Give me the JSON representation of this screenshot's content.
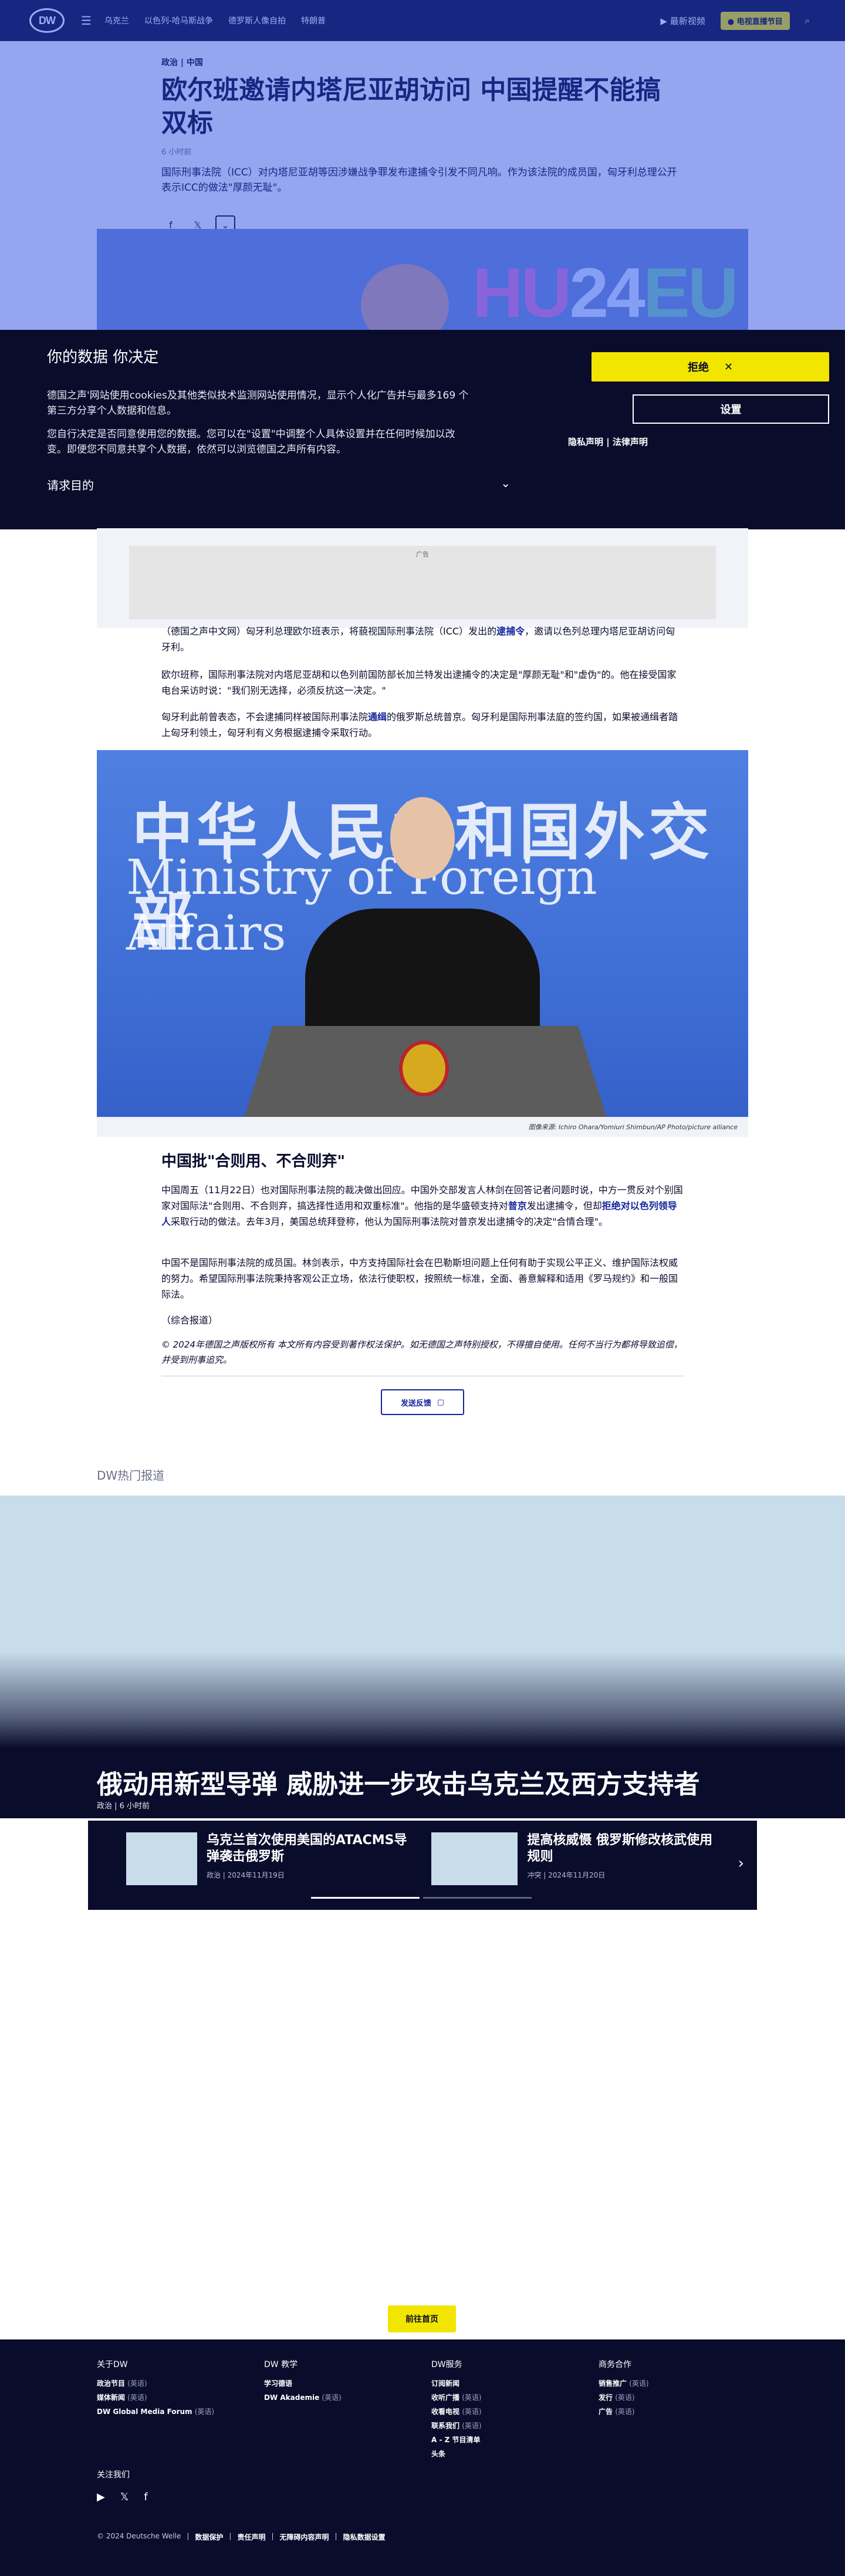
{
  "topbar": {
    "logo": "DW",
    "menu_icon": "menu-icon",
    "nav": [
      "乌克兰",
      "以色列-哈马斯战争",
      "德罗斯人像自拍",
      "特朗普"
    ],
    "live_audio": "最新视频",
    "live_btn": "● 电视直播节目",
    "search_icon": "search-icon"
  },
  "article": {
    "kicker": "政治 | 中国",
    "title": "欧尔班邀请内塔尼亚胡访问 中国提醒不能搞双标",
    "meta": "6 小时前",
    "lead": "国际刑事法院（ICC）对内塔尼亚胡等因涉嫌战争罪发布逮捕令引发不同凡响。作为该法院的成员国，匈牙利总理公开表示ICC的做法\"厚颜无耻\"。",
    "share_icons": [
      "facebook-icon",
      "x-icon",
      "more-icon"
    ]
  },
  "hero": {
    "text_hu": "HU",
    "text_num": "24",
    "text_eu": "EU"
  },
  "cookie": {
    "title": "你的数据 你决定",
    "p1": "德国之声'网站使用cookies及其他类似技术监测网站使用情况，显示个人化广告并与最多169 个第三方分享个人数据和信息。",
    "p2": "您自行决定是否同意使用您的数据。您可以在\"设置\"中调整个人具体设置并在任何时候加以改变。即便您不同意共享个人数据，依然可以浏览德国之声所有内容。",
    "purpose": "请求目的",
    "purpose_icon": "chevron-down-icon",
    "reject": "拒绝",
    "settings": "设置",
    "legal": "隐私声明 | 法律声明"
  },
  "ad": {
    "label": "广告"
  },
  "paragraphs": {
    "p1_a": "（德国之声中文网）匈牙利总理欧尔班表示，将藐视国际刑事法院（ICC）发出的",
    "p1_link": "逮捕令",
    "p1_b": "，邀请以色列总理内塔尼亚胡访问匈牙利。",
    "p2": "欧尔班称，国际刑事法院对内塔尼亚胡和以色列前国防部长加兰特发出逮捕令的决定是\"厚颜无耻\"和\"虚伪\"的。他在接受国家电台采访时说：\"我们别无选择，必须反抗这一决定。\"",
    "p3_a": "匈牙利此前曾表态，不会逮捕同样被国际刑事法院",
    "p3_link": "通缉",
    "p3_b": "的俄罗斯总统普京。匈牙利是国际刑事法庭的签约国，如果被通缉者踏上匈牙利领土，匈牙利有义务根据逮捕令采取行动。",
    "h2": "中国批\"合则用、不合则弃\"",
    "p4_a": "中国周五（11月22日）也对国际刑事法院的裁决做出回应。中国外交部发言人林剑在回答记者问题时说，中方一贯反对个别国家对国际法\"合则用、不合则弃，搞选择性适用和双重标准\"。他指的是华盛顿支持对",
    "p4_link1": "普京",
    "p4_b": "发出逮捕令，但却",
    "p4_link2": "拒绝对以色列领导人",
    "p4_c": "采取行动的做法。去年3月，美国总统拜登称，他认为国际刑事法院对普京发出逮捕令的决定\"合情合理\"。",
    "p5": "中国不是国际刑事法院的成员国。林剑表示，中方支持国际社会在巴勒斯坦问题上任何有助于实现公平正义、维护国际法权威的努力。希望国际刑事法院秉持客观公正立场，依法行使职权，按照统一标准，全面、善意解释和适用《罗马规约》和一般国际法。",
    "p6": "（综合报道）",
    "copyright": "© 2024年德国之声版权所有 本文所有内容受到著作权法保护。如无德国之声特别授权，不得擅自使用。任何不当行为都将导致追偿，并受到刑事追究。",
    "feedback": "发送反馈"
  },
  "photo": {
    "sign_line1": "中华人民共和国外交部",
    "sign_line2": "Ministry of Foreign Affairs",
    "caption": "图像来源: Ichiro Ohara/Yomiuri Shimbun/AP Photo/picture alliance"
  },
  "hot": {
    "section_title": "DW热门报道",
    "feature_title": "俄动用新型导弹 威胁进一步攻击乌克兰及西方支持者",
    "feature_meta": "政治 | 6 小时前",
    "cards": [
      {
        "title": "乌克兰首次使用美国的ATACMS导弹袭击俄罗斯",
        "meta": "政治 | 2024年11月19日"
      },
      {
        "title": "提高核威慑 俄罗斯修改核武使用规则",
        "meta": "冲突 | 2024年11月20日"
      }
    ],
    "more": "前往首页"
  },
  "footer": {
    "cols": [
      {
        "title": "关于DW",
        "items": [
          {
            "b": "政治节目",
            "s": "(英语)"
          },
          {
            "b": "媒体新闻",
            "s": "(英语)"
          },
          {
            "b": "DW Global Media Forum",
            "s": "(英语)"
          }
        ]
      },
      {
        "title": "DW 教学",
        "items": [
          {
            "b": "学习德语",
            "s": ""
          },
          {
            "b": "DW Akademie",
            "s": "(英语)"
          }
        ]
      },
      {
        "title": "DW服务",
        "items": [
          {
            "b": "订阅新闻",
            "s": ""
          },
          {
            "b": "收听广播",
            "s": "(英语)"
          },
          {
            "b": "收看电视",
            "s": "(英语)"
          },
          {
            "b": "联系我们",
            "s": "(英语)"
          },
          {
            "b": "A - Z 节目清单",
            "s": ""
          },
          {
            "b": "头条",
            "s": ""
          }
        ]
      },
      {
        "title": "商务合作",
        "items": [
          {
            "b": "销售推广",
            "s": "(英语)"
          },
          {
            "b": "发行",
            "s": "(英语)"
          },
          {
            "b": "广告",
            "s": "(英语)"
          }
        ]
      }
    ],
    "follow": "关注我们",
    "socials": [
      "youtube-icon",
      "x-icon",
      "facebook-icon"
    ],
    "bottom": [
      "© 2024 Deutsche Welle",
      "数据保护",
      "责任声明",
      "无障碍内容声明",
      "隐私数据设置"
    ]
  }
}
